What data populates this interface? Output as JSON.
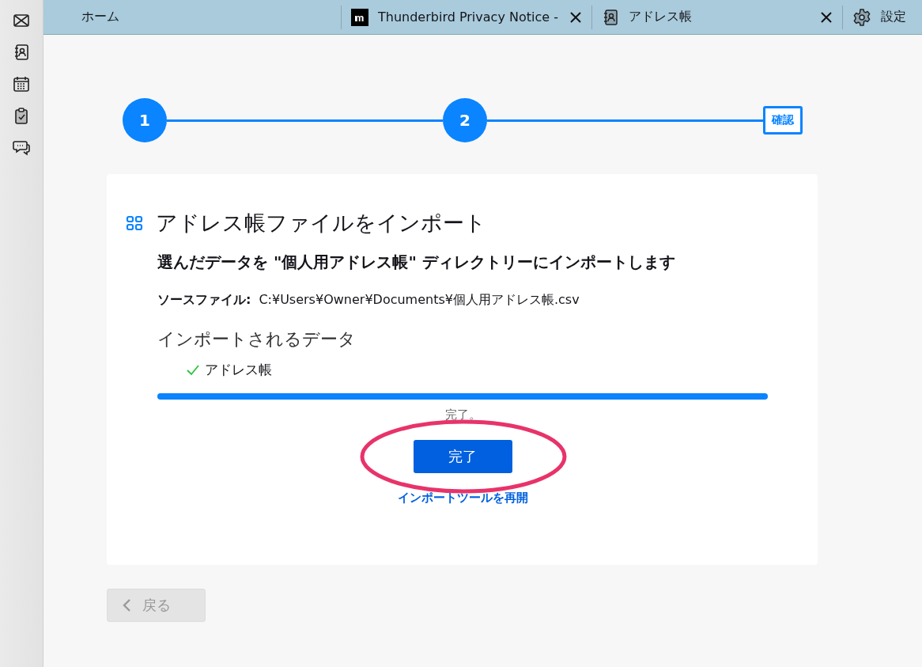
{
  "spaces": [
    {
      "kind": "mail"
    },
    {
      "kind": "address-book"
    },
    {
      "kind": "calendar"
    },
    {
      "kind": "tasks"
    },
    {
      "kind": "chat"
    }
  ],
  "tabs": [
    {
      "label": "ホーム",
      "kind": "home",
      "closable": false
    },
    {
      "label": "Thunderbird Privacy Notice -",
      "kind": "web",
      "closable": true
    },
    {
      "label": "アドレス帳",
      "kind": "address-book",
      "closable": true
    },
    {
      "label": "設定",
      "kind": "settings",
      "closable": false
    }
  ],
  "steps": [
    {
      "label": "1",
      "current": false
    },
    {
      "label": "2",
      "current": false
    },
    {
      "label": "確認",
      "current": true
    }
  ],
  "card": {
    "title": "アドレス帳ファイルをインポート",
    "heading": "選んだデータを \"個人用アドレス帳\" ディレクトリーにインポートします",
    "source_label": "ソースファイル:",
    "source_path": "C:¥Users¥Owner¥Documents¥個人用アドレス帳.csv",
    "data_heading": "インポートされるデータ",
    "items": [
      {
        "label": "アドレス帳",
        "checked": true
      }
    ],
    "progress": {
      "level": 1
    },
    "status": "完了。",
    "finish_button": "完了",
    "restart_link": "インポートツールを再開",
    "highlighted": true
  },
  "back_button": {
    "label": "戻る",
    "disabled": true
  }
}
